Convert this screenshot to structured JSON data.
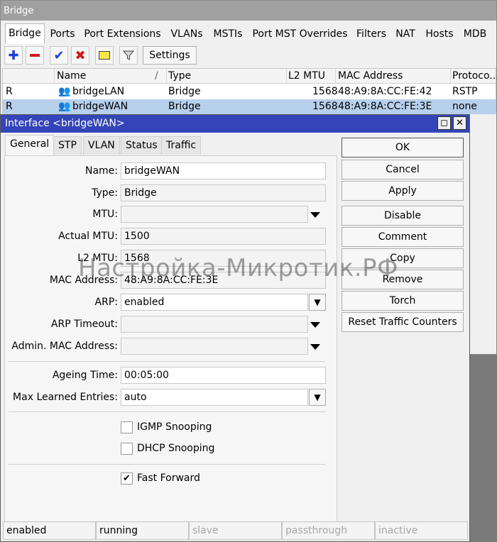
{
  "bridge_window": {
    "title": "Bridge",
    "tabs": [
      "Bridge",
      "Ports",
      "Port Extensions",
      "VLANs",
      "MSTIs",
      "Port MST Overrides",
      "Filters",
      "NAT",
      "Hosts",
      "MDB"
    ],
    "active_tab": "Bridge",
    "toolbar": {
      "add_icon": "plus-icon",
      "remove_icon": "minus-icon",
      "enable_icon": "check-icon",
      "disable_icon": "cross-icon",
      "comment_icon": "note-icon",
      "filter_icon": "funnel-icon",
      "settings_label": "Settings"
    },
    "table": {
      "columns": [
        "",
        "Name",
        "Type",
        "L2 MTU",
        "MAC Address",
        "Protoco..."
      ],
      "sort_indicator": "/",
      "rows": [
        {
          "flag": "R",
          "name": "bridgeLAN",
          "type": "Bridge",
          "l2mtu": "1568",
          "mac": "48:A9:8A:CC:FE:42",
          "protocol": "RSTP",
          "selected": false
        },
        {
          "flag": "R",
          "name": "bridgeWAN",
          "type": "Bridge",
          "l2mtu": "1568",
          "mac": "48:A9:8A:CC:FE:3E",
          "protocol": "none",
          "selected": true
        }
      ]
    }
  },
  "interface_dialog": {
    "title": "Interface <bridgeWAN>",
    "restore_glyph": "◻",
    "close_glyph": "✕",
    "tabs": [
      "General",
      "STP",
      "VLAN",
      "Status",
      "Traffic"
    ],
    "active_tab": "General",
    "fields": {
      "name": {
        "label": "Name:",
        "value": "bridgeWAN"
      },
      "type": {
        "label": "Type:",
        "value": "Bridge"
      },
      "mtu": {
        "label": "MTU:",
        "value": ""
      },
      "actual_mtu": {
        "label": "Actual MTU:",
        "value": "1500"
      },
      "l2_mtu": {
        "label": "L2 MTU:",
        "value": "1568"
      },
      "mac_address": {
        "label": "MAC Address:",
        "value": "48:A9:8A:CC:FE:3E"
      },
      "arp": {
        "label": "ARP:",
        "value": "enabled"
      },
      "arp_timeout": {
        "label": "ARP Timeout:",
        "value": ""
      },
      "admin_mac": {
        "label": "Admin. MAC Address:",
        "value": ""
      },
      "ageing_time": {
        "label": "Ageing Time:",
        "value": "00:05:00"
      },
      "max_learned": {
        "label": "Max Learned Entries:",
        "value": "auto"
      }
    },
    "checkboxes": {
      "igmp_snooping": {
        "label": "IGMP Snooping",
        "checked": false
      },
      "dhcp_snooping": {
        "label": "DHCP Snooping",
        "checked": false
      },
      "fast_forward": {
        "label": "Fast Forward",
        "checked": true,
        "mark": "✔"
      }
    },
    "buttons": [
      "OK",
      "Cancel",
      "Apply",
      "Disable",
      "Comment",
      "Copy",
      "Remove",
      "Torch",
      "Reset Traffic Counters"
    ],
    "status_bar": [
      "enabled",
      "running",
      "slave",
      "passthrough",
      "inactive"
    ]
  },
  "watermark": "Настройка-Микротик.РФ",
  "colors": {
    "dialog_title": "#3345b8",
    "selected_row": "#b7d0ec",
    "add_icon": "#1a3fd1",
    "remove_icon": "#d11a1a"
  }
}
